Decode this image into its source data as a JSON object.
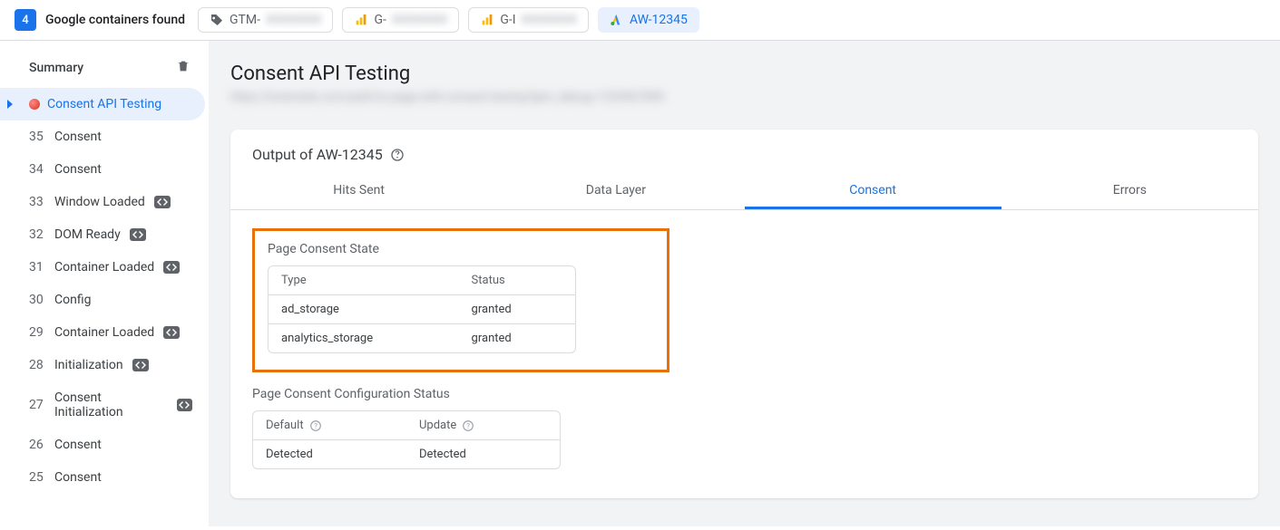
{
  "top": {
    "count": "4",
    "label": "Google containers found",
    "chips": [
      {
        "prefix": "GTM-",
        "active": false,
        "icon": "tag"
      },
      {
        "prefix": "G-",
        "active": false,
        "icon": "analytics"
      },
      {
        "prefix": "G-I",
        "active": false,
        "icon": "analytics"
      },
      {
        "prefix": "AW-12345",
        "active": true,
        "icon": "ads"
      }
    ]
  },
  "sidebar": {
    "summary_label": "Summary",
    "active_label": "Consent API Testing",
    "items": [
      {
        "num": "35",
        "label": "Consent",
        "code": false
      },
      {
        "num": "34",
        "label": "Consent",
        "code": false
      },
      {
        "num": "33",
        "label": "Window Loaded",
        "code": true
      },
      {
        "num": "32",
        "label": "DOM Ready",
        "code": true
      },
      {
        "num": "31",
        "label": "Container Loaded",
        "code": true
      },
      {
        "num": "30",
        "label": "Config",
        "code": false
      },
      {
        "num": "29",
        "label": "Container Loaded",
        "code": true
      },
      {
        "num": "28",
        "label": "Initialization",
        "code": true
      },
      {
        "num": "27",
        "label": "Consent Initialization",
        "code": true
      },
      {
        "num": "26",
        "label": "Consent",
        "code": false
      },
      {
        "num": "25",
        "label": "Consent",
        "code": false
      }
    ]
  },
  "main": {
    "title": "Consent API Testing",
    "subtitle_blur": "https://loremsite.com/path/to-page-with-consent-testing?gtm_debug=1234567890",
    "card_title": "Output of AW-12345",
    "tabs": [
      "Hits Sent",
      "Data Layer",
      "Consent",
      "Errors"
    ],
    "active_tab": "Consent",
    "consent_state": {
      "heading": "Page Consent State",
      "headers": [
        "Type",
        "Status"
      ],
      "rows": [
        {
          "type": "ad_storage",
          "status": "granted"
        },
        {
          "type": "analytics_storage",
          "status": "granted"
        }
      ]
    },
    "config_status": {
      "heading": "Page Consent Configuration Status",
      "headers": [
        "Default",
        "Update"
      ],
      "values": [
        "Detected",
        "Detected"
      ]
    }
  }
}
